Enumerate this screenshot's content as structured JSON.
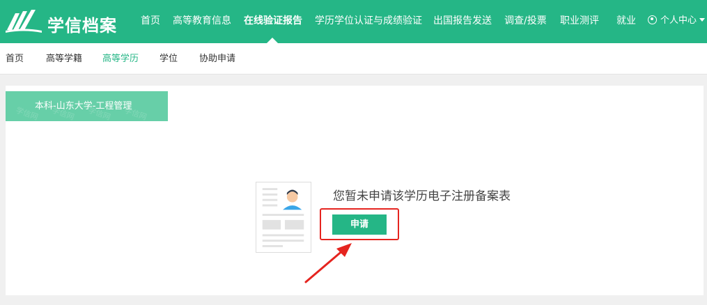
{
  "header": {
    "logo_text": "学信档案",
    "nav": [
      {
        "label": "首页"
      },
      {
        "label": "高等教育信息"
      },
      {
        "label": "在线验证报告"
      },
      {
        "label": "学历学位认证与成绩验证"
      },
      {
        "label": "出国报告发送"
      },
      {
        "label": "调查/投票"
      },
      {
        "label": "职业测评"
      },
      {
        "label": "就业"
      }
    ],
    "active_nav": "在线验证报告",
    "user_center_label": "个人中心"
  },
  "subnav": {
    "items": [
      {
        "label": "首页"
      },
      {
        "label": "高等学籍"
      },
      {
        "label": "高等学历"
      },
      {
        "label": "学位"
      },
      {
        "label": "协助申请"
      }
    ],
    "active": "高等学历"
  },
  "record": {
    "tab_label": "本科-山东大学-工程管理",
    "watermark_text": "学信网"
  },
  "empty_state": {
    "message": "您暂未申请该学历电子注册备案表",
    "apply_label": "申请"
  },
  "colors": {
    "brand": "#25b686",
    "tag": "#67cfa8",
    "annotation": "#e5241f"
  }
}
